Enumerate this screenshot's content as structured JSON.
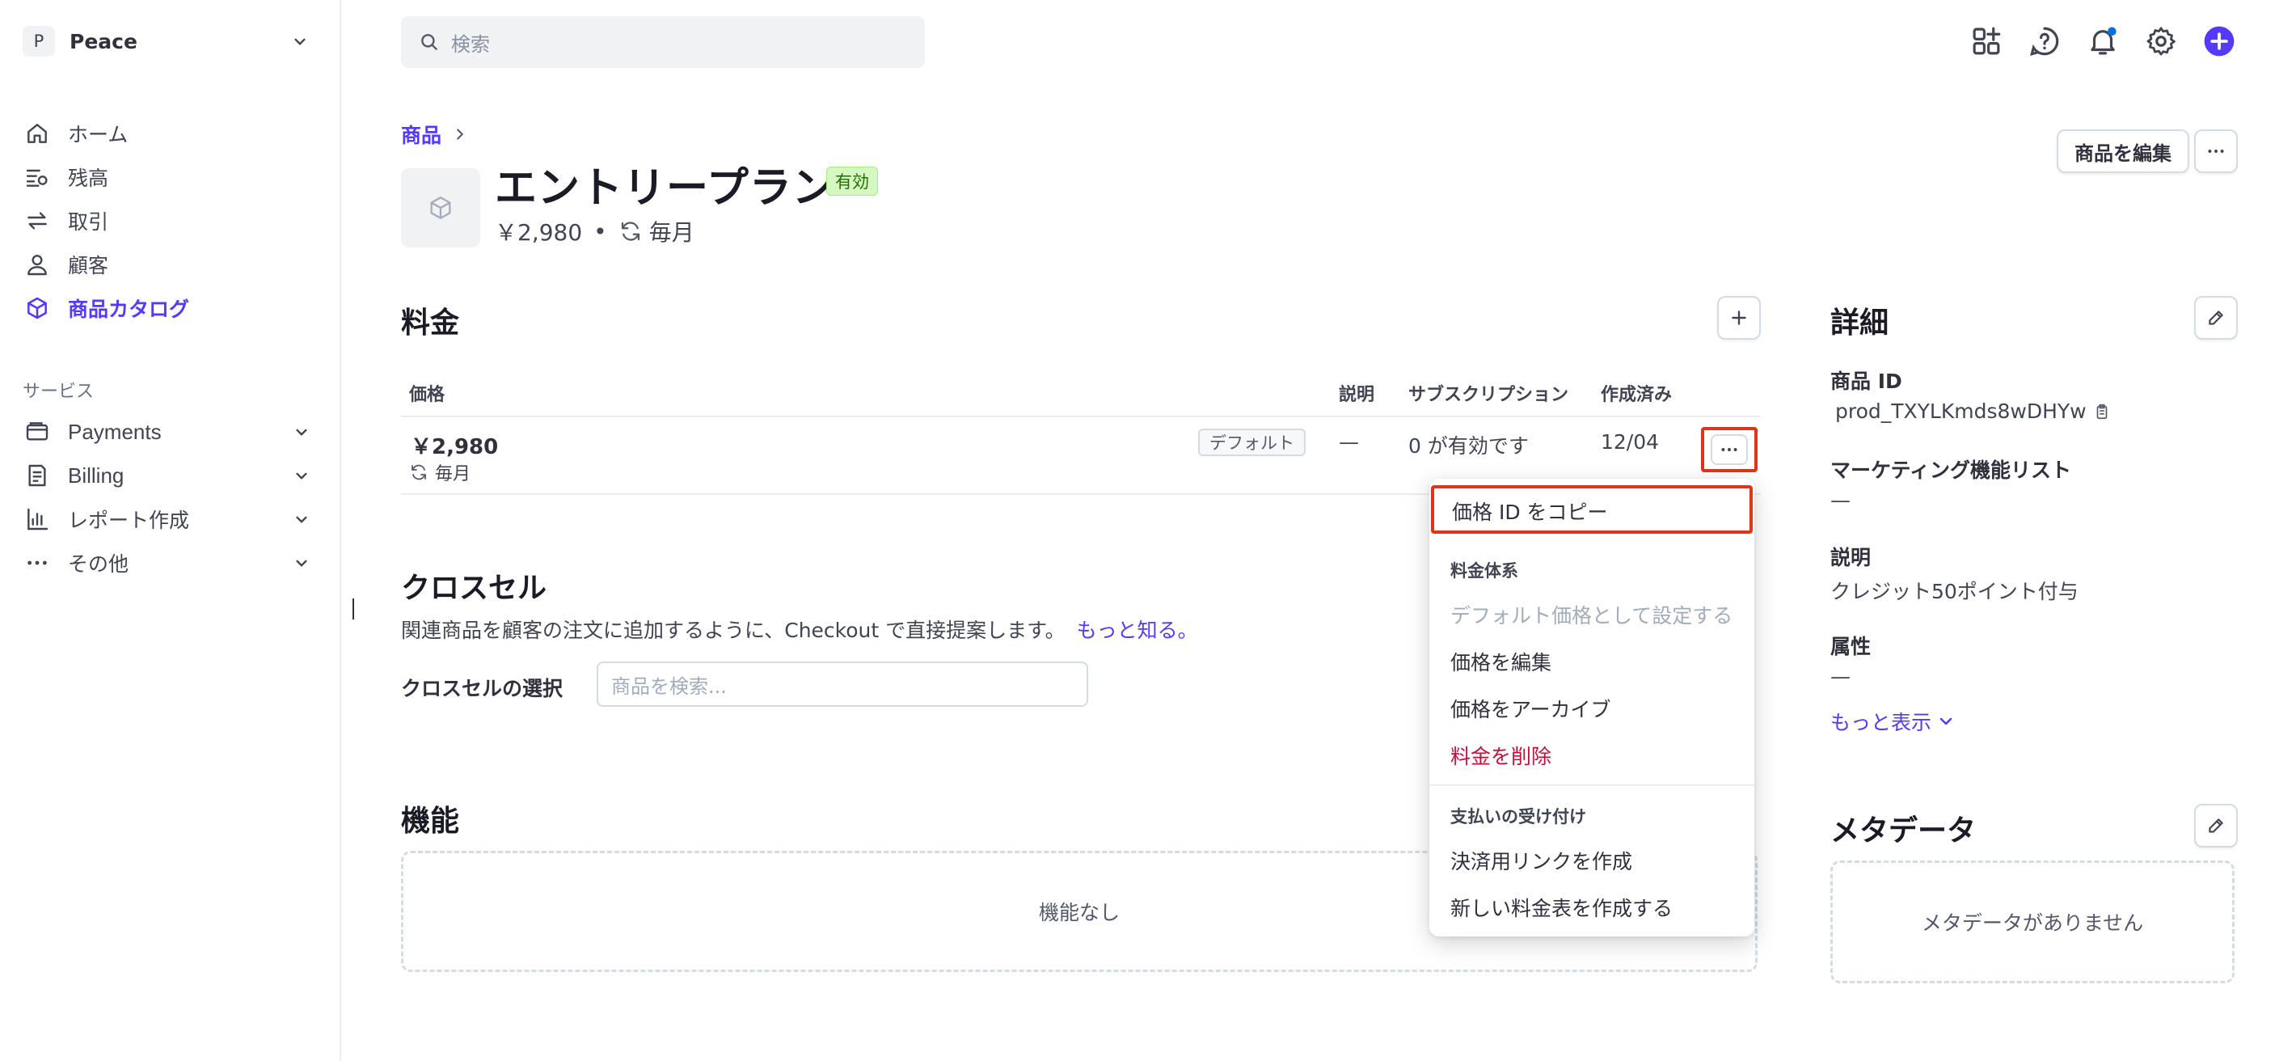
{
  "sidebar": {
    "account": {
      "initial": "P",
      "name": "Peace"
    },
    "nav": [
      {
        "label": "ホーム",
        "icon": "home-icon"
      },
      {
        "label": "残高",
        "icon": "balance-icon"
      },
      {
        "label": "取引",
        "icon": "transactions-icon"
      },
      {
        "label": "顧客",
        "icon": "person-icon"
      },
      {
        "label": "商品カタログ",
        "icon": "product-box-icon",
        "active": true
      }
    ],
    "section_label": "サービス",
    "services": [
      {
        "label": "Payments",
        "icon": "wallet-icon"
      },
      {
        "label": "Billing",
        "icon": "invoice-icon"
      },
      {
        "label": "レポート作成",
        "icon": "bar-chart-icon"
      },
      {
        "label": "その他",
        "icon": "more-dots-icon"
      }
    ]
  },
  "topbar": {
    "search_placeholder": "検索",
    "icons": [
      "apps-add-icon",
      "help-icon",
      "notifications-icon",
      "settings-icon",
      "create-plus-icon"
    ]
  },
  "breadcrumb": {
    "parent": "商品"
  },
  "product": {
    "name": "エントリープラン",
    "status": "有効",
    "price": "￥2,980",
    "interval": "毎月",
    "edit_label": "商品を編集"
  },
  "pricing": {
    "title": "料金",
    "columns": [
      "価格",
      "説明",
      "サブスクリプション",
      "作成済み"
    ],
    "rows": [
      {
        "price": "￥2,980",
        "interval": "毎月",
        "badge": "デフォルト",
        "description": "—",
        "subscriptions": "0 が有効です",
        "created": "12/04"
      }
    ]
  },
  "context_menu": {
    "copy_id": "価格 ID をコピー",
    "group1_title": "料金体系",
    "set_default": "デフォルト価格として設定する",
    "edit_price": "価格を編集",
    "archive_price": "価格をアーカイブ",
    "delete_price": "料金を削除",
    "group2_title": "支払いの受け付け",
    "create_payment_link": "決済用リンクを作成",
    "create_pricing_table": "新しい料金表を作成する"
  },
  "cross_sell": {
    "title": "クロスセル",
    "description": "関連商品を顧客の注文に追加するように、Checkout で直接提案します。",
    "learn_more": "もっと知る。",
    "select_label": "クロスセルの選択",
    "search_placeholder": "商品を検索..."
  },
  "features": {
    "title": "機能",
    "empty": "機能なし"
  },
  "details": {
    "title": "詳細",
    "product_id_label": "商品 ID",
    "product_id": "prod_TXYLKmds8wDHYw",
    "marketing_label": "マーケティング機能リスト",
    "marketing_value": "—",
    "description_label": "説明",
    "description_value": "クレジット50ポイント付与",
    "attributes_label": "属性",
    "attributes_value": "—",
    "show_more": "もっと表示"
  },
  "metadata": {
    "title": "メタデータ",
    "empty": "メタデータがありません"
  },
  "colors": {
    "accent": "#533afd",
    "highlight": "#e0351a",
    "danger": "#c0123c",
    "active_badge_bg": "#d7f7c2"
  }
}
